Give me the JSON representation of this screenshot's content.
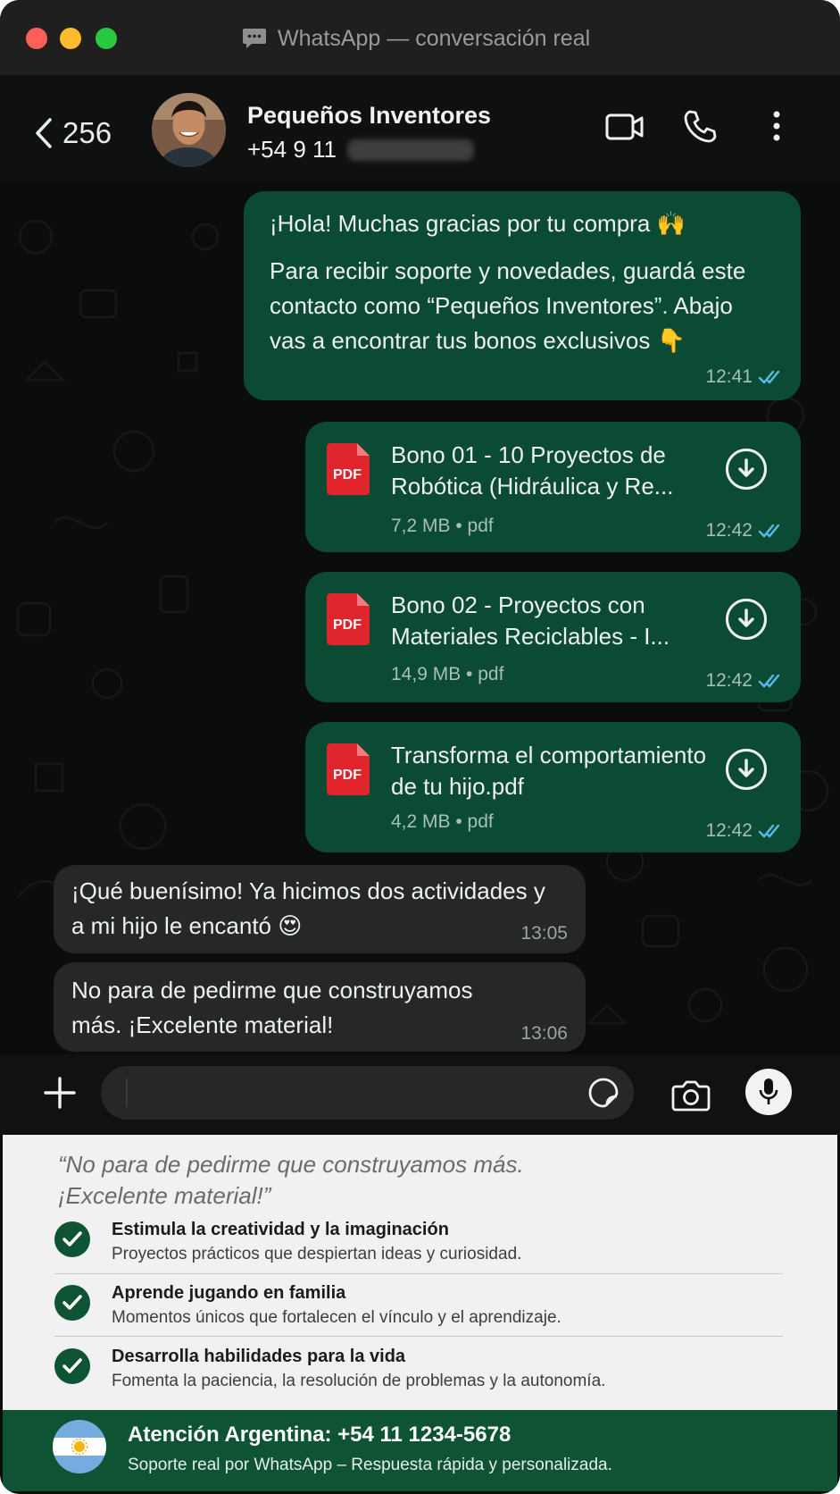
{
  "window": {
    "title": "WhatsApp — conversación real",
    "title_icon": "chat-bubble-icon"
  },
  "header": {
    "back_count": "256",
    "contact_name": "Pequeños Inventores",
    "contact_phone_visible": "+54 9 11",
    "icons": [
      "back-chevron-icon",
      "video-call-icon",
      "phone-icon",
      "more-options-icon"
    ]
  },
  "messages": [
    {
      "direction": "outgoing",
      "paragraphs": [
        "¡Hola! Muchas gracias por tu compra 🙌",
        "Para recibir soporte y novedades, guardá este contacto como “Pequeños Inventores”. Abajo vas a encontrar tus bonos exclusivos 👇"
      ],
      "time": "12:41",
      "status": "read-double-check"
    },
    {
      "direction": "outgoing",
      "type": "document",
      "title": "Bono 01 - 10 Proyectos de Robótica (Hidráulica y Re...",
      "meta": "7,2 MB • pdf",
      "time": "12:42",
      "status": "read-double-check"
    },
    {
      "direction": "outgoing",
      "type": "document",
      "title": "Bono 02 - Proyectos con Materiales Reciclables - I...",
      "meta": "14,9 MB • pdf",
      "time": "12:42",
      "status": "read-double-check"
    },
    {
      "direction": "outgoing",
      "type": "document",
      "title": "Transforma el comportamiento de tu hijo.pdf",
      "meta": "4,2 MB • pdf",
      "time": "12:42",
      "status": "read-double-check"
    },
    {
      "direction": "incoming",
      "text": "¡Qué buenísimo! Ya hicimos dos actividades y a mi hijo le encantó 😍",
      "time": "13:05"
    },
    {
      "direction": "incoming",
      "text": "No para de pedirme que construyamos más. ¡Excelente material!",
      "time": "13:06"
    }
  ],
  "pdf_icon_label": "PDF",
  "input_bar": {
    "icons": [
      "plus-icon",
      "sticker-icon",
      "camera-icon",
      "microphone-icon"
    ]
  },
  "testimonial": {
    "quote": "“No para de pedirme que construyamos más. ¡Excelente material!”",
    "benefits": [
      {
        "title": "Estimula la creatividad y la imaginación",
        "description": "Proyectos prácticos que despiertan ideas y curiosidad."
      },
      {
        "title": "Aprende jugando en familia",
        "description": "Momentos únicos que fortalecen el vínculo y el aprendizaje."
      },
      {
        "title": "Desarrolla habilidades para la vida",
        "description": "Fomenta la paciencia, la resolución de problemas y la autonomía."
      }
    ]
  },
  "footer": {
    "title": "Atención Argentina: +54 11 1234-5678",
    "description": "Soporte real por WhatsApp – Respuesta rápida y personalizada.",
    "flag_icon": "argentina-flag-icon"
  },
  "colors": {
    "outgoing_bubble": "#0b4a33",
    "incoming_bubble": "#252826",
    "read_tick": "#53bdeb",
    "brand_green": "#0d5334",
    "pdf_red": "#e0242c"
  }
}
